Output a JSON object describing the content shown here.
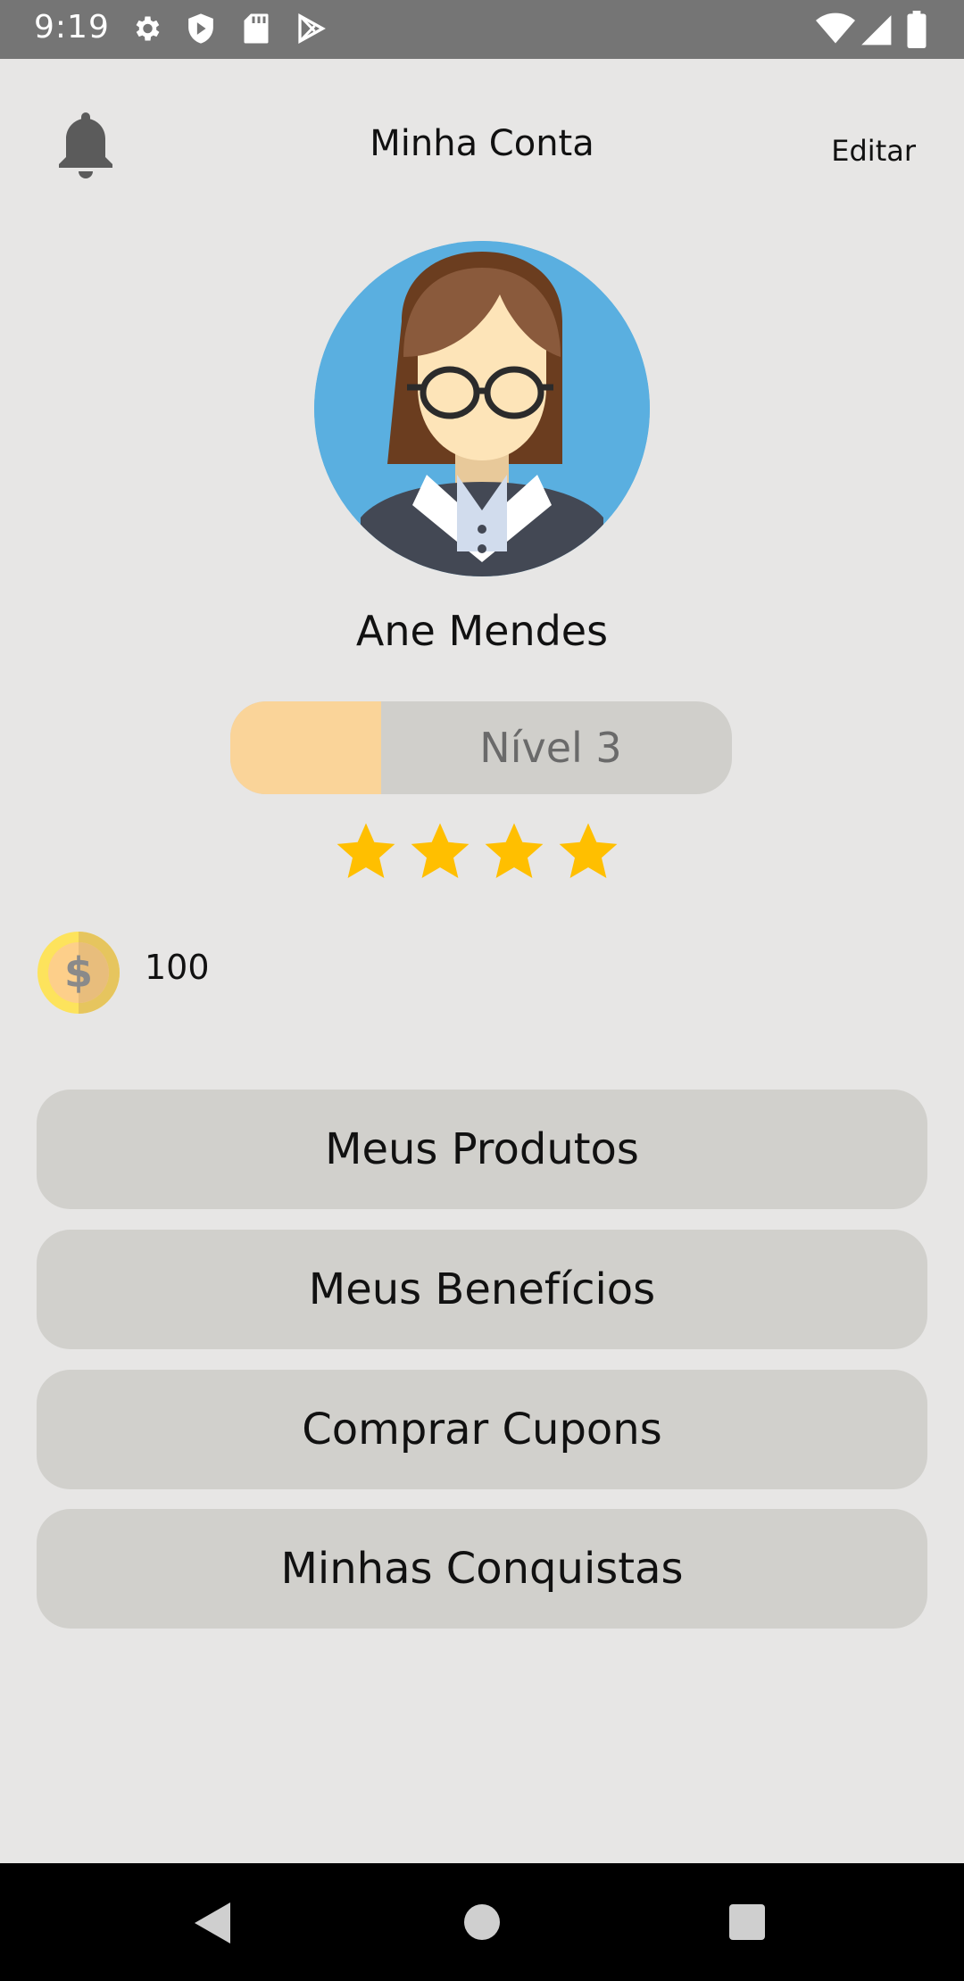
{
  "status_bar": {
    "time": "9:19",
    "icons": [
      "gear-icon",
      "shield-icon",
      "sd-card-icon",
      "play-store-icon",
      "wifi-icon",
      "signal-icon",
      "battery-icon"
    ]
  },
  "header": {
    "title": "Minha Conta",
    "edit_label": "Editar",
    "notification_icon": "bell-icon"
  },
  "profile": {
    "name": "Ane Mendes",
    "level_label": "Nível 3",
    "level_progress": 0.3,
    "stars": 4,
    "coins": "100",
    "avatar_colors": {
      "background": "#5aafe0",
      "hair": "#8a5a3c",
      "skin": "#fde4b8"
    }
  },
  "menu": [
    {
      "label": "Meus Produtos"
    },
    {
      "label": "Meus Benefícios"
    },
    {
      "label": "Comprar Cupons"
    },
    {
      "label": "Minhas Conquistas"
    }
  ],
  "colors": {
    "background": "#e7e6e5",
    "button": "#d1d0cc",
    "level_fill": "#fad499",
    "star": "#ffbf00"
  },
  "nav_bar": {
    "icons": [
      "back-icon",
      "home-icon",
      "recents-icon"
    ]
  }
}
